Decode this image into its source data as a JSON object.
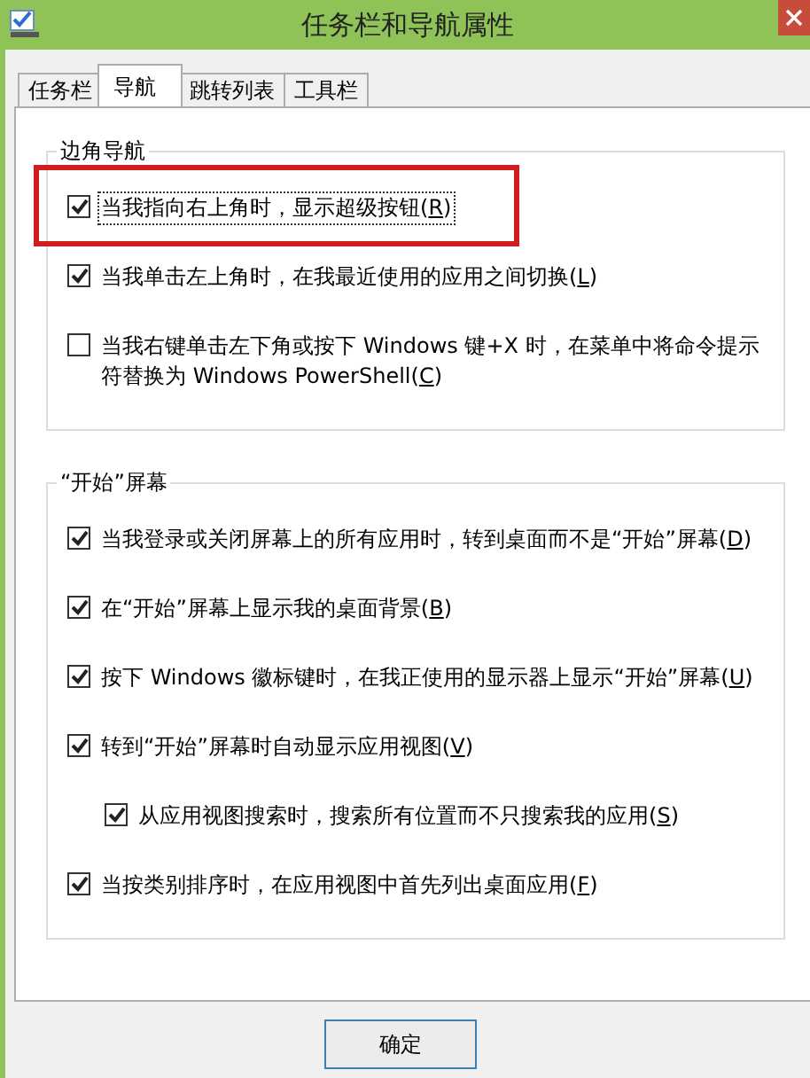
{
  "window": {
    "title": "任务栏和导航属性"
  },
  "tabs": [
    {
      "label": "任务栏",
      "selected": false
    },
    {
      "label": "导航",
      "selected": true
    },
    {
      "label": "跳转列表",
      "selected": false
    },
    {
      "label": "工具栏",
      "selected": false
    }
  ],
  "groups": [
    {
      "title": "边角导航",
      "items": [
        {
          "label": "当我指向右上角时，显示超级按钮(",
          "access_key": "R",
          "label_end": ")",
          "checked": true,
          "focused": true,
          "highlighted": true
        },
        {
          "label": "当我单击左上角时，在我最近使用的应用之间切换(",
          "access_key": "L",
          "label_end": ")",
          "checked": true
        },
        {
          "label": "当我右键单击左下角或按下 Windows 键+X 时，在菜单中将命令提示符替换为 Windows PowerShell(",
          "access_key": "C",
          "label_end": ")",
          "checked": false
        }
      ]
    },
    {
      "title": "“开始”屏幕",
      "items": [
        {
          "label": "当我登录或关闭屏幕上的所有应用时，转到桌面而不是“开始”屏幕(",
          "access_key": "D",
          "label_end": ")",
          "checked": true
        },
        {
          "label": "在“开始”屏幕上显示我的桌面背景(",
          "access_key": "B",
          "label_end": ")",
          "checked": true
        },
        {
          "label": "按下 Windows 徽标键时，在我正使用的显示器上显示“开始”屏幕(",
          "access_key": "U",
          "label_end": ")",
          "checked": true
        },
        {
          "label": "转到“开始”屏幕时自动显示应用视图(",
          "access_key": "V",
          "label_end": ")",
          "checked": true,
          "children": [
            {
              "label": "从应用视图搜索时，搜索所有位置而不只搜索我的应用(",
              "access_key": "S",
              "label_end": ")",
              "checked": true
            }
          ]
        },
        {
          "label": "当按类别排序时，在应用视图中首先列出桌面应用(",
          "access_key": "F",
          "label_end": ")",
          "checked": true
        }
      ]
    }
  ],
  "buttons": [
    {
      "label": "确定"
    }
  ]
}
